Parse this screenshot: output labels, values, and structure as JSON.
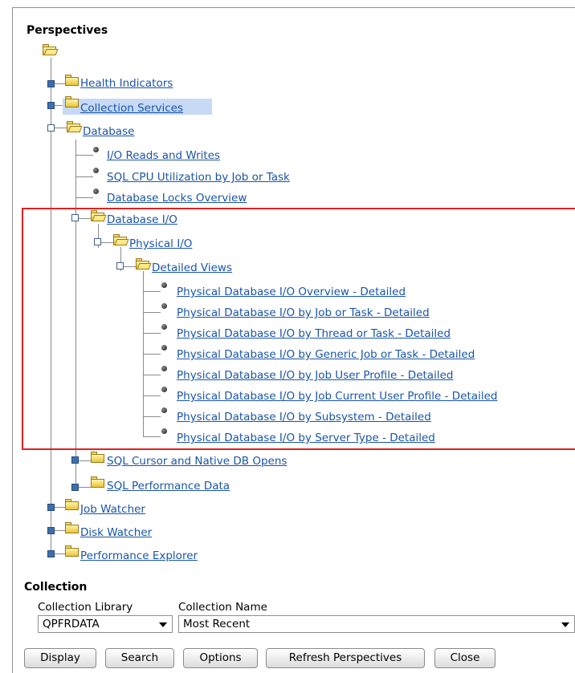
{
  "perspectives_heading": "Perspectives",
  "tree": {
    "health_indicators": "Health Indicators",
    "collection_services": "Collection Services",
    "database": "Database",
    "io_reads_writes": "I/O Reads and Writes",
    "sql_cpu": "SQL CPU Utilization by Job or Task",
    "db_locks": "Database Locks Overview",
    "database_io": "Database I/O",
    "physical_io": "Physical I/O",
    "detailed_views": "Detailed Views",
    "detailed_items": [
      "Physical Database I/O Overview - Detailed",
      "Physical Database I/O by Job or Task - Detailed",
      "Physical Database I/O by Thread or Task - Detailed",
      "Physical Database I/O by Generic Job or Task - Detailed",
      "Physical Database I/O by Job User Profile - Detailed",
      "Physical Database I/O by Job Current User Profile - Detailed",
      "Physical Database I/O by Subsystem - Detailed",
      "Physical Database I/O by Server Type - Detailed"
    ],
    "sql_cursor": "SQL Cursor and Native DB Opens",
    "sql_performance": "SQL Performance Data",
    "job_watcher": "Job Watcher",
    "disk_watcher": "Disk Watcher",
    "performance_explorer": "Performance Explorer"
  },
  "collection": {
    "heading": "Collection",
    "library_label": "Collection Library",
    "library_value": "QPFRDATA",
    "name_label": "Collection Name",
    "name_value": "Most Recent"
  },
  "buttons": {
    "display": "Display",
    "search": "Search",
    "options": "Options",
    "refresh": "Refresh Perspectives",
    "close": "Close"
  },
  "colors": {
    "link": "#1a55a8",
    "highlight_box": "#e02020",
    "selected_bg": "#c7d9f4"
  }
}
